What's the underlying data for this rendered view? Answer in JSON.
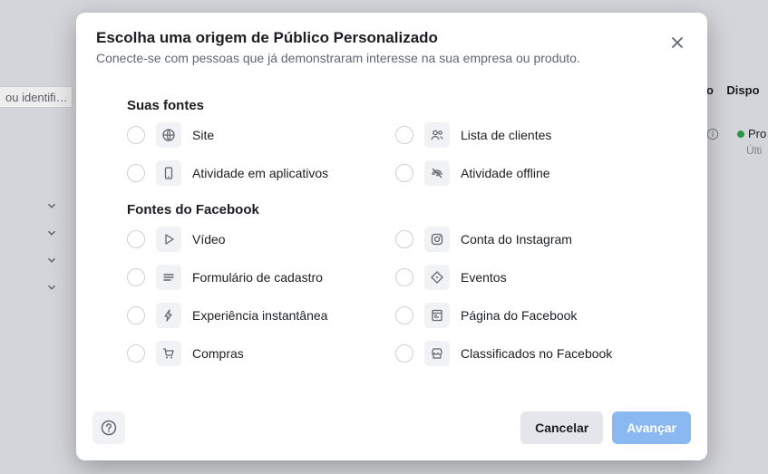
{
  "background": {
    "search_fragment": "ou identifi…",
    "col_header_right_1": "o",
    "col_header_right_2": "Dispo",
    "status_text": "Pro",
    "status_sub": "Últi"
  },
  "modal": {
    "title": "Escolha uma origem de Público Personalizado",
    "subtitle": "Conecte-se com pessoas que já demonstraram interesse na sua empresa ou produto.",
    "section_your_sources": "Suas fontes",
    "section_fb_sources": "Fontes do Facebook",
    "your_sources": [
      {
        "label": "Site",
        "icon": "globe-icon",
        "name": "source-site"
      },
      {
        "label": "Lista de clientes",
        "icon": "people-icon",
        "name": "source-customer-list"
      },
      {
        "label": "Atividade em aplicativos",
        "icon": "mobile-icon",
        "name": "source-app-activity"
      },
      {
        "label": "Atividade offline",
        "icon": "offline-icon",
        "name": "source-offline-activity"
      }
    ],
    "fb_sources": [
      {
        "label": "Vídeo",
        "icon": "play-icon",
        "name": "source-video"
      },
      {
        "label": "Conta do Instagram",
        "icon": "instagram-icon",
        "name": "source-instagram"
      },
      {
        "label": "Formulário de cadastro",
        "icon": "form-icon",
        "name": "source-lead-form"
      },
      {
        "label": "Eventos",
        "icon": "tag-icon",
        "name": "source-events"
      },
      {
        "label": "Experiência instantânea",
        "icon": "bolt-icon",
        "name": "source-instant-exp"
      },
      {
        "label": "Página do Facebook",
        "icon": "page-icon",
        "name": "source-fb-page"
      },
      {
        "label": "Compras",
        "icon": "cart-icon",
        "name": "source-shopping"
      },
      {
        "label": "Classificados no Facebook",
        "icon": "marketplace-icon",
        "name": "source-marketplace"
      }
    ],
    "buttons": {
      "cancel": "Cancelar",
      "next": "Avançar"
    }
  }
}
